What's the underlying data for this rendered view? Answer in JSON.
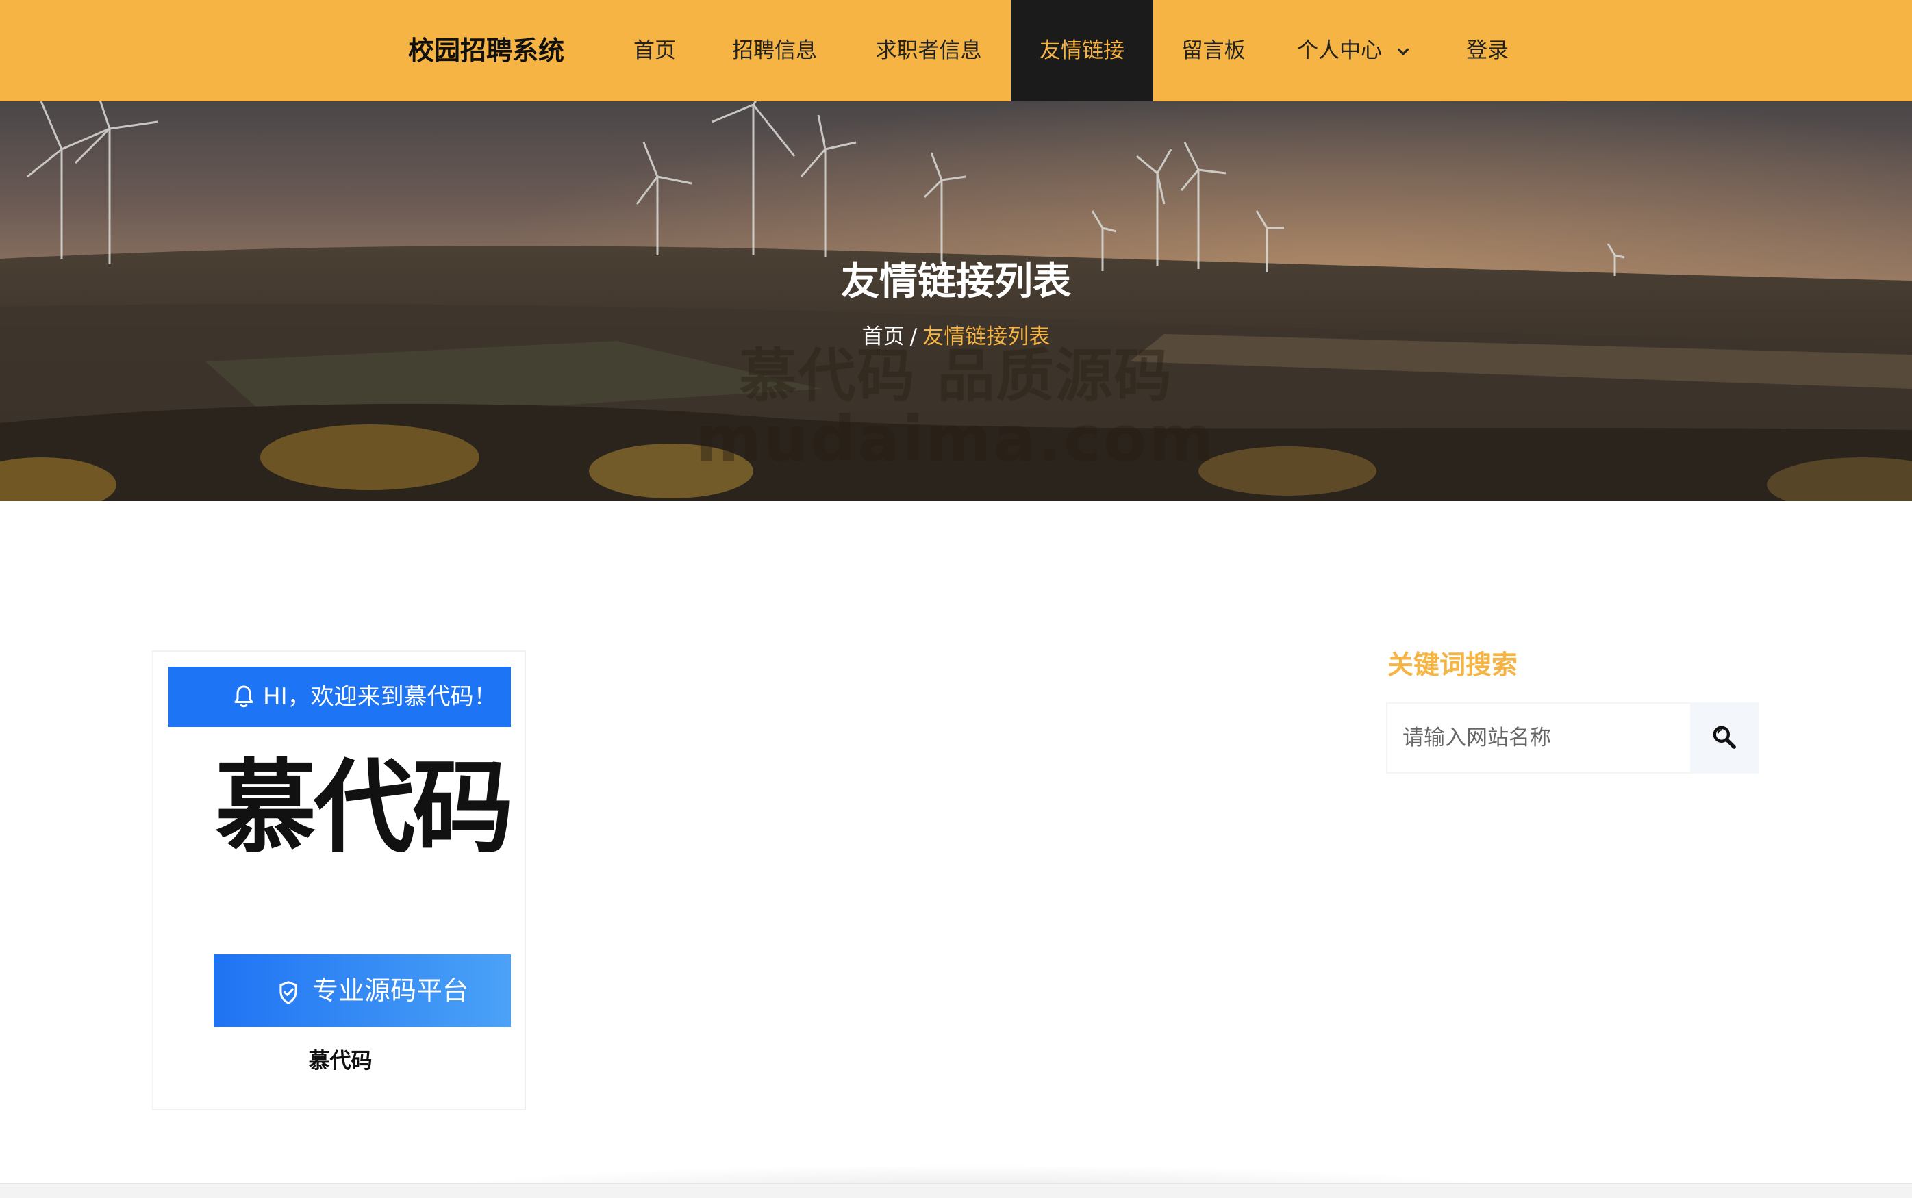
{
  "nav": {
    "brand": "校园招聘系统",
    "items": [
      {
        "label": "首页"
      },
      {
        "label": "招聘信息"
      },
      {
        "label": "求职者信息"
      },
      {
        "label": "友情链接"
      },
      {
        "label": "留言板"
      },
      {
        "label": "个人中心"
      },
      {
        "label": "登录"
      }
    ],
    "active_item": "友情链接",
    "dropdown_icon": "chevron-down-icon"
  },
  "hero": {
    "title": "友情链接列表",
    "breadcrumb": {
      "home": "首页",
      "separator": "/",
      "current": "友情链接列表"
    },
    "watermark_line1": "慕代码 品质源码",
    "watermark_line2": "mudaima.com"
  },
  "links": [
    {
      "name": "慕代码",
      "image": {
        "welcome_text": "HI，欢迎来到慕代码！",
        "logo_text": "慕代码",
        "slogan": "专业源码平台",
        "bell_icon": "bell-icon",
        "shield_icon": "shield-check-icon"
      }
    }
  ],
  "sidebar": {
    "title": "关键词搜索",
    "search_placeholder": "请输入网站名称",
    "search_icon": "search-icon"
  },
  "colors": {
    "accent": "#f5b443",
    "nav_active_bg": "#1b1b1b",
    "card_blue": "#1d74f5"
  }
}
